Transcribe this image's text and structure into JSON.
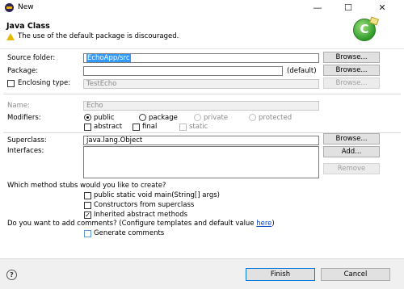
{
  "window": {
    "title": "New",
    "minimize": "—",
    "maximize": "☐",
    "close": "✕"
  },
  "header": {
    "title": "Java Class",
    "warning": "The use of the default package is discouraged.",
    "logo_glyph": "C"
  },
  "source_folder": {
    "label": "Source folder:",
    "value": "EchoApp/src",
    "browse": "Browse..."
  },
  "package": {
    "label": "Package:",
    "value": "",
    "default_hint": "(default)",
    "browse": "Browse..."
  },
  "enclosing": {
    "label": "Enclosing type:",
    "value": "TestEcho",
    "browse": "Browse...",
    "checked": false
  },
  "name": {
    "label": "Name:",
    "value": "Echo"
  },
  "modifiers": {
    "label": "Modifiers:",
    "options": [
      "public",
      "package",
      "private",
      "protected"
    ],
    "selected": "public",
    "flags": [
      "abstract",
      "final",
      "static"
    ]
  },
  "superclass": {
    "label": "Superclass:",
    "value": "java.lang.Object",
    "browse": "Browse..."
  },
  "interfaces": {
    "label": "Interfaces:",
    "add": "Add...",
    "remove": "Remove"
  },
  "stubs": {
    "question": "Which method stubs would you like to create?",
    "items": [
      {
        "label": "public static void main(String[] args)",
        "checked": false
      },
      {
        "label": "Constructors from superclass",
        "checked": false
      },
      {
        "label": "Inherited abstract methods",
        "checked": true
      }
    ]
  },
  "comments": {
    "question": "Do you want to add comments? (Configure templates and default value ",
    "link": "here",
    "suffix": ")",
    "generate": "Generate comments",
    "checked": false
  },
  "footer": {
    "help": "?",
    "finish": "Finish",
    "cancel": "Cancel"
  }
}
